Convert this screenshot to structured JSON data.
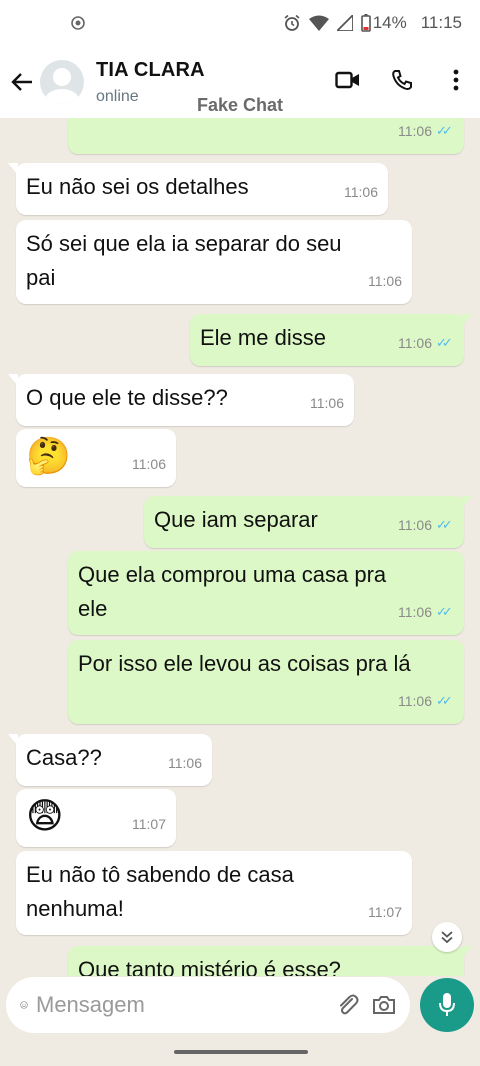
{
  "status_bar": {
    "battery": "14%",
    "time": "11:15"
  },
  "header": {
    "contact_name": "TIA CLARA",
    "contact_status": "online",
    "watermark": "Fake Chat"
  },
  "messages": [
    {
      "dir": "out",
      "text": "",
      "time": "11:06",
      "read": true
    },
    {
      "dir": "in",
      "text": "Eu não sei os detalhes",
      "time": "11:06"
    },
    {
      "dir": "in",
      "text": "Só sei que ela ia separar do seu pai",
      "time": "11:06"
    },
    {
      "dir": "out",
      "text": "Ele me disse",
      "time": "11:06",
      "read": true
    },
    {
      "dir": "in",
      "text": "O que ele te disse??",
      "time": "11:06"
    },
    {
      "dir": "in",
      "text": "🤔",
      "time": "11:06"
    },
    {
      "dir": "out",
      "text": "Que iam separar",
      "time": "11:06",
      "read": true
    },
    {
      "dir": "out",
      "text": "Que ela comprou uma casa pra ele",
      "time": "11:06",
      "read": true
    },
    {
      "dir": "out",
      "text": "Por isso ele levou as coisas pra lá",
      "time": "11:06",
      "read": true
    },
    {
      "dir": "in",
      "text": "Casa??",
      "time": "11:06"
    },
    {
      "dir": "in",
      "text": "😨",
      "time": "11:07"
    },
    {
      "dir": "in",
      "text": "Eu não tô sabendo de casa nenhuma!",
      "time": "11:07"
    },
    {
      "dir": "out",
      "text": "Que tanto mistério é esse?",
      "time": ""
    }
  ],
  "composer": {
    "placeholder": "Mensagem"
  },
  "colors": {
    "chat_bg": "#efeae2",
    "bubble_out": "#dcf8c6",
    "bubble_in": "#ffffff",
    "accent": "#1a9a89",
    "read_ticks": "#53bdeb"
  }
}
